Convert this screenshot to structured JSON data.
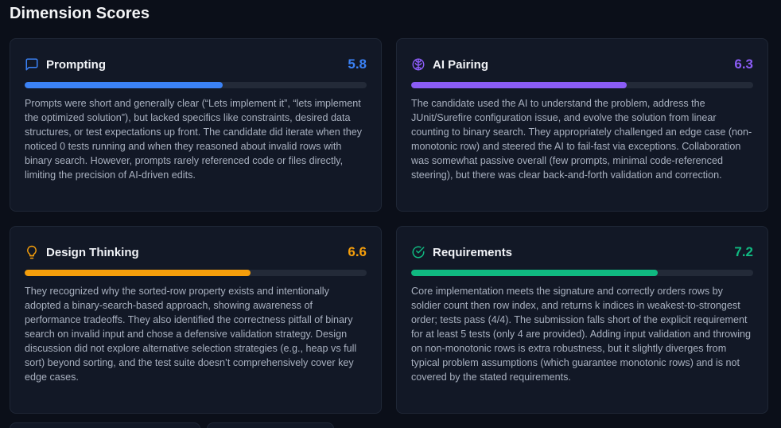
{
  "section": {
    "title": "Dimension Scores"
  },
  "cards": [
    {
      "title": "Prompting",
      "icon": "message-square-icon",
      "score": "5.8",
      "score_value": 5.8,
      "max_score": 10,
      "accent": "#3b82f6",
      "text": "Prompts were short and generally clear (“Lets implement it”, “lets implement the optimized solution”), but lacked specifics like constraints, desired data structures, or test expectations up front. The candidate did iterate when they noticed 0 tests running and when they reasoned about invalid rows with binary search. However, prompts rarely referenced code or files directly, limiting the precision of AI-driven edits."
    },
    {
      "title": "AI Pairing",
      "icon": "brain-icon",
      "score": "6.3",
      "score_value": 6.3,
      "max_score": 10,
      "accent": "#8b5cf6",
      "text": "The candidate used the AI to understand the problem, address the JUnit/Surefire configuration issue, and evolve the solution from linear counting to binary search. They appropriately challenged an edge case (non-monotonic row) and steered the AI to fail-fast via exceptions. Collaboration was somewhat passive overall (few prompts, minimal code-referenced steering), but there was clear back-and-forth validation and correction."
    },
    {
      "title": "Design Thinking",
      "icon": "lightbulb-icon",
      "score": "6.6",
      "score_value": 6.6,
      "max_score": 10,
      "accent": "#f59e0b",
      "text": "They recognized why the sorted-row property exists and intentionally adopted a binary-search-based approach, showing awareness of performance tradeoffs. They also identified the correctness pitfall of binary search on invalid input and chose a defensive validation strategy. Design discussion did not explore alternative selection strategies (e.g., heap vs full sort) beyond sorting, and the test suite doesn’t comprehensively cover key edge cases."
    },
    {
      "title": "Requirements",
      "icon": "check-circle-icon",
      "score": "7.2",
      "score_value": 7.2,
      "max_score": 10,
      "accent": "#10b981",
      "text": "Core implementation meets the signature and correctly orders rows by soldier count then row index, and returns k indices in weakest-to-strongest order; tests pass (4/4). The submission falls short of the explicit requirement for at least 5 tests (only 4 are provided). Adding input validation and throwing on non-monotonic rows is extra robustness, but it slightly diverges from typical problem assumptions (which guarantee monotonic rows) and is not covered by the stated requirements."
    }
  ]
}
